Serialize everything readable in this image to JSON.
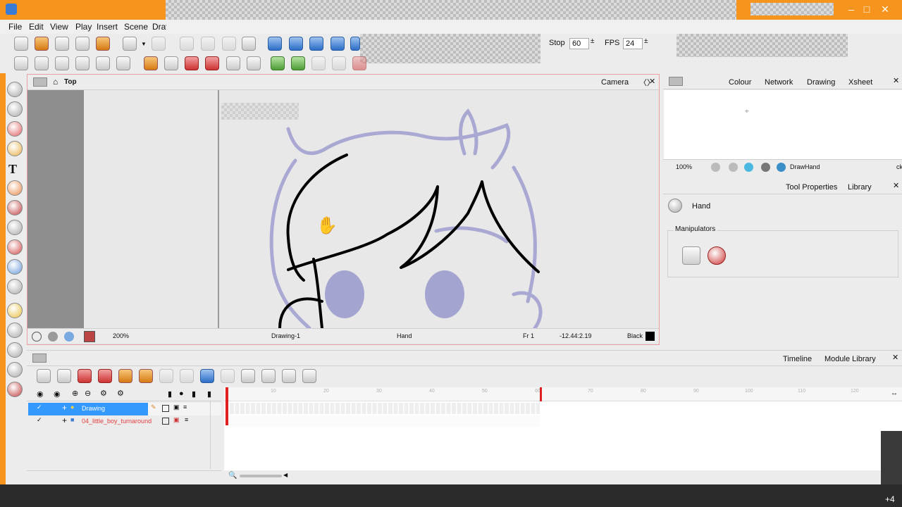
{
  "menu": [
    "File",
    "Edit",
    "View",
    "Play",
    "Insert",
    "Scene",
    "Draw"
  ],
  "playback": {
    "stop_label": "Stop",
    "stop_value": "60",
    "fps_label": "FPS",
    "fps_value": "24"
  },
  "viewport": {
    "view_name": "Top",
    "camera_tab": "Camera",
    "zoom": "200%",
    "drawing_name": "Drawing-1",
    "tool": "Hand",
    "frame": "Fr 1",
    "coords": "-12.44:2.19",
    "color_name": "Black"
  },
  "right_tabs": [
    "Colour",
    "Network",
    "Drawing",
    "Xsheet"
  ],
  "drawing_panel": {
    "zoom": "100%",
    "tool": "DrawHand",
    "cut_text": "ck"
  },
  "tool_properties": {
    "tabs": [
      "Tool Properties",
      "Library"
    ],
    "tool_name": "Hand",
    "group_label": "Manipulators"
  },
  "timeline": {
    "tabs": [
      "Timeline",
      "Module Library"
    ],
    "ticks": [
      "10",
      "20",
      "30",
      "40",
      "50",
      "60",
      "70",
      "80",
      "90",
      "100",
      "110",
      "120"
    ],
    "layers": [
      {
        "name": "Drawing",
        "selected": true
      },
      {
        "name": "04_little_boy_turnaround",
        "selected": false
      }
    ]
  },
  "taskbar": {
    "badge": "+4"
  },
  "colors": {
    "accent": "#f7941d",
    "selection": "#3399ff",
    "stroke": "#000000",
    "sketch": "#8e8eca"
  }
}
